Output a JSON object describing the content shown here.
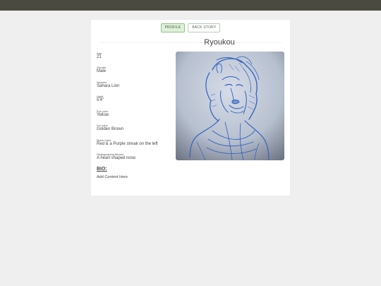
{
  "tabs": [
    {
      "label": "PROFILE",
      "active": true
    },
    {
      "label": "BACK STORY",
      "active": false
    }
  ],
  "character": {
    "name": "Ryoukou",
    "fields": [
      {
        "label": "Age",
        "value": "21"
      },
      {
        "label": "Gender",
        "value": "Male"
      },
      {
        "label": "Species",
        "value": "Sahara Lion"
      },
      {
        "label": "Hight",
        "value": "5'4\""
      },
      {
        "label": "Eye color",
        "value": "Yellow"
      },
      {
        "label": "Fur color",
        "value": "Golden Brown"
      },
      {
        "label": "Mane Color",
        "value": "Red & a Purple streak on the left"
      },
      {
        "label": "Distinguishing fetures",
        "value": "A heart shaped nose"
      }
    ]
  },
  "bio": {
    "heading": "BIO:",
    "content": "Add Content Here"
  },
  "colors": {
    "topbar": "#4b4a40",
    "page_background": "#efefef",
    "active_tab": "#dff0da",
    "sketch_ink": "#2d5fbf"
  }
}
